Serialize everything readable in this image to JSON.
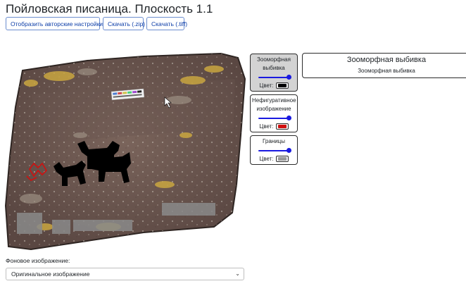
{
  "page": {
    "title": "Пойловская писаница. Плоскость 1.1"
  },
  "toolbar": {
    "show_settings": "Отобразить авторские настройки",
    "download_zip": "Скачать (.zip)",
    "download_tiff": "Скачать (.tiff)"
  },
  "layers": [
    {
      "label": "Зооморфная выбивка",
      "color_label": "Цвет:",
      "color": "#000000",
      "opacity": 1.0,
      "active": true
    },
    {
      "label": "Нефигуративное изображение",
      "color_label": "Цвет:",
      "color": "#d01010",
      "opacity": 1.0,
      "active": false
    },
    {
      "label": "Границы",
      "color_label": "Цвет:",
      "color": "#999999",
      "opacity": 1.0,
      "active": false
    }
  ],
  "info_panel": {
    "heading": "Зооморфная выбивка",
    "subtitle": "Зооморфная выбивка"
  },
  "background": {
    "label": "Фоновое изображение:",
    "selected": "Оригинальное изображение"
  },
  "colors": {
    "rock_base": "#6e5a52",
    "rock_dark": "#4e3f3a",
    "lichen": "#c9a640",
    "accent_blue": "#1a1ae0"
  },
  "icons": {
    "chevron": "chevron-down-icon"
  }
}
